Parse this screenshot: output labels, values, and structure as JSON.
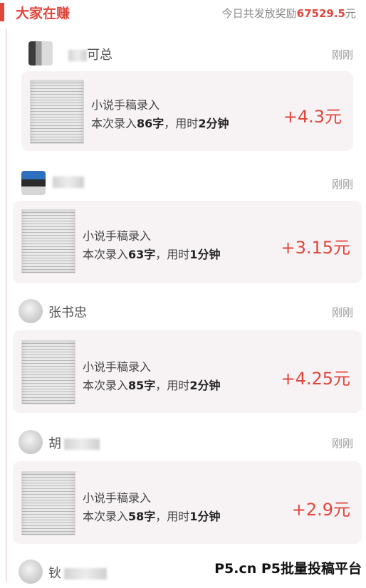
{
  "header": {
    "title": "大家在赚",
    "total_prefix": "今日共发放奖励",
    "total_amount": "67529.5",
    "total_suffix": "元"
  },
  "entries": [
    {
      "name": "可总",
      "time": "刚刚",
      "task": "小说手稿录入",
      "detail_prefix": "本次录入",
      "chars": "86字",
      "detail_mid": "，用时",
      "duration": "2分钟",
      "amount": "+4.3元"
    },
    {
      "name": "",
      "time": "刚刚",
      "task": "小说手稿录入",
      "detail_prefix": "本次录入",
      "chars": "63字",
      "detail_mid": "，用时",
      "duration": "1分钟",
      "amount": "+3.15元"
    },
    {
      "name": "张书忠",
      "time": "刚刚",
      "task": "小说手稿录入",
      "detail_prefix": "本次录入",
      "chars": "85字",
      "detail_mid": "，用时",
      "duration": "2分钟",
      "amount": "+4.25元"
    },
    {
      "name": "胡",
      "time": "刚刚",
      "task": "小说手稿录入",
      "detail_prefix": "本次录入",
      "chars": "58字",
      "detail_mid": "，用时",
      "duration": "1分钟",
      "amount": "+2.9元"
    },
    {
      "name": "钬",
      "time": "",
      "task": "",
      "detail_prefix": "",
      "chars": "",
      "detail_mid": "",
      "duration": "",
      "amount": ""
    }
  ],
  "watermark": "P5.cn P5批量投稿平台"
}
